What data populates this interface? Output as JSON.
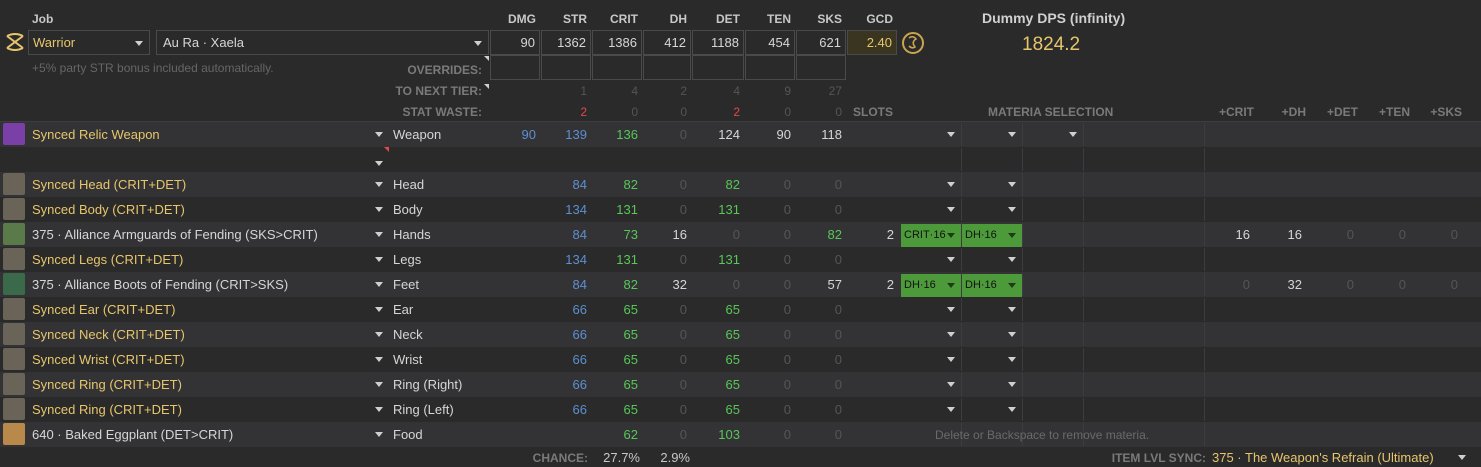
{
  "header": {
    "job_label": "Job",
    "job_value": "Warrior",
    "race_value": "Au Ra · Xaela",
    "note": "+5% party STR bonus included automatically.",
    "stat_headers": [
      "DMG",
      "STR",
      "CRIT",
      "DH",
      "DET",
      "TEN",
      "SKS",
      "GCD"
    ],
    "stat_values": [
      "90",
      "1362",
      "1386",
      "412",
      "1188",
      "454",
      "621",
      "2.40"
    ],
    "dps_title": "Dummy DPS (infinity)",
    "dps_value": "1824.2",
    "overrides_label": "OVERRIDES:",
    "next_tier_label": "TO NEXT TIER:",
    "next_tier_values": [
      "1",
      "4",
      "2",
      "4",
      "9",
      "27"
    ],
    "stat_waste_label": "STAT WASTE:",
    "stat_waste_values": [
      "2",
      "0",
      "0",
      "2",
      "0",
      "0"
    ],
    "slots_label": "SLOTS",
    "materia_label": "MATERIA SELECTION",
    "bonus_headers": [
      "+CRIT",
      "+DH",
      "+DET",
      "+TEN",
      "+SKS"
    ]
  },
  "gear": [
    {
      "name": "Synced Relic Weapon",
      "slot": "Weapon",
      "dmg": "90",
      "str": "139",
      "crit": "136",
      "dh": "0",
      "det": "124",
      "ten": "90",
      "sks": "118",
      "nslots": "",
      "m1": "",
      "m2": "",
      "bonus": [
        "",
        "",
        "",
        "",
        ""
      ]
    },
    {
      "name": "",
      "slot": "",
      "dmg": "",
      "str": "",
      "crit": "",
      "dh": "",
      "det": "",
      "ten": "",
      "sks": "",
      "nslots": "",
      "m1": "",
      "m2": "",
      "bonus": [
        "",
        "",
        "",
        "",
        ""
      ]
    },
    {
      "name": "Synced Head (CRIT+DET)",
      "slot": "Head",
      "dmg": "",
      "str": "84",
      "crit": "82",
      "dh": "0",
      "det": "82",
      "ten": "0",
      "sks": "0",
      "nslots": "",
      "m1": "",
      "m2": "",
      "bonus": [
        "",
        "",
        "",
        "",
        ""
      ]
    },
    {
      "name": "Synced Body (CRIT+DET)",
      "slot": "Body",
      "dmg": "",
      "str": "134",
      "crit": "131",
      "dh": "0",
      "det": "131",
      "ten": "0",
      "sks": "0",
      "nslots": "",
      "m1": "",
      "m2": "",
      "bonus": [
        "",
        "",
        "",
        "",
        ""
      ]
    },
    {
      "name": "375 · Alliance Armguards of Fending (SKS>CRIT)",
      "slot": "Hands",
      "dmg": "",
      "str": "84",
      "crit": "73",
      "dh": "16",
      "det": "0",
      "ten": "0",
      "sks": "82",
      "nslots": "2",
      "m1": "CRIT·16",
      "m2": "DH·16",
      "bonus": [
        "16",
        "16",
        "0",
        "0",
        "0"
      ]
    },
    {
      "name": "Synced Legs (CRIT+DET)",
      "slot": "Legs",
      "dmg": "",
      "str": "134",
      "crit": "131",
      "dh": "0",
      "det": "131",
      "ten": "0",
      "sks": "0",
      "nslots": "",
      "m1": "",
      "m2": "",
      "bonus": [
        "",
        "",
        "",
        "",
        ""
      ]
    },
    {
      "name": "375 · Alliance Boots of Fending (CRIT>SKS)",
      "slot": "Feet",
      "dmg": "",
      "str": "84",
      "crit": "82",
      "dh": "32",
      "det": "0",
      "ten": "0",
      "sks": "57",
      "nslots": "2",
      "m1": "DH·16",
      "m2": "DH·16",
      "bonus": [
        "0",
        "32",
        "0",
        "0",
        "0"
      ]
    },
    {
      "name": "Synced Ear (CRIT+DET)",
      "slot": "Ear",
      "dmg": "",
      "str": "66",
      "crit": "65",
      "dh": "0",
      "det": "65",
      "ten": "0",
      "sks": "0",
      "nslots": "",
      "m1": "",
      "m2": "",
      "bonus": [
        "",
        "",
        "",
        "",
        ""
      ]
    },
    {
      "name": "Synced Neck (CRIT+DET)",
      "slot": "Neck",
      "dmg": "",
      "str": "66",
      "crit": "65",
      "dh": "0",
      "det": "65",
      "ten": "0",
      "sks": "0",
      "nslots": "",
      "m1": "",
      "m2": "",
      "bonus": [
        "",
        "",
        "",
        "",
        ""
      ]
    },
    {
      "name": "Synced Wrist (CRIT+DET)",
      "slot": "Wrist",
      "dmg": "",
      "str": "66",
      "crit": "65",
      "dh": "0",
      "det": "65",
      "ten": "0",
      "sks": "0",
      "nslots": "",
      "m1": "",
      "m2": "",
      "bonus": [
        "",
        "",
        "",
        "",
        ""
      ]
    },
    {
      "name": "Synced Ring (CRIT+DET)",
      "slot": "Ring (Right)",
      "dmg": "",
      "str": "66",
      "crit": "65",
      "dh": "0",
      "det": "65",
      "ten": "0",
      "sks": "0",
      "nslots": "",
      "m1": "",
      "m2": "",
      "bonus": [
        "",
        "",
        "",
        "",
        ""
      ]
    },
    {
      "name": "Synced Ring (CRIT+DET)",
      "slot": "Ring (Left)",
      "dmg": "",
      "str": "66",
      "crit": "65",
      "dh": "0",
      "det": "65",
      "ten": "0",
      "sks": "0",
      "nslots": "",
      "m1": "",
      "m2": "",
      "bonus": [
        "",
        "",
        "",
        "",
        ""
      ]
    },
    {
      "name": "640 · Baked Eggplant (DET>CRIT)",
      "slot": "Food",
      "dmg": "",
      "str": "",
      "crit": "62",
      "dh": "0",
      "det": "103",
      "ten": "0",
      "sks": "0",
      "nslots": "",
      "m1": "",
      "m2": "",
      "bonus": [
        "",
        "",
        "",
        "",
        ""
      ]
    }
  ],
  "footer": {
    "delete_hint": "Delete or Backspace to remove materia.",
    "chance_label": "CHANCE:",
    "chance_crit": "27.7%",
    "chance_dh": "2.9%",
    "sync_label": "ITEM LVL SYNC:",
    "sync_value": "375 · The Weapon's Refrain (Ultimate)"
  },
  "colors": {
    "accent": "#e7c66b",
    "strength": "#5d8fd1",
    "secondary": "#58c758",
    "materia": "#4d9a3b",
    "waste": "#e24848"
  }
}
